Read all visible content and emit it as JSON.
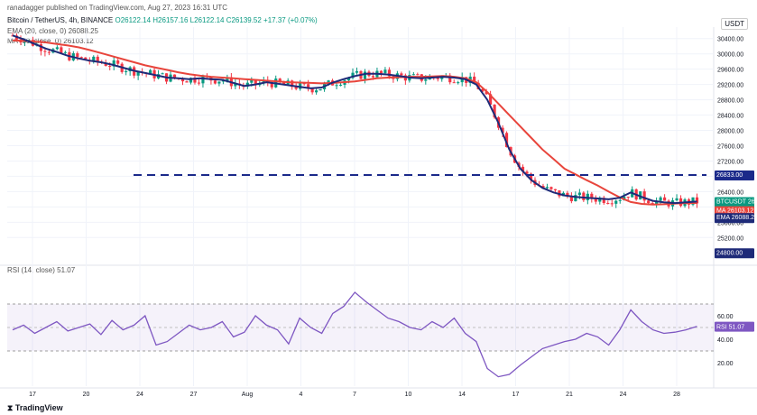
{
  "header": "ranadagger published on TradingView.com, Aug 27, 2023 16:31 UTC",
  "symbol_line": {
    "name": "Bitcoin / TetherUS, 4h, BINANCE",
    "ohlc": "O26122.14  H26157.16  L26122.14  C26139.52  +17.37 (+0.07%)"
  },
  "indicators": [
    {
      "label": "EMA (20, close, 0)",
      "value": "26088.25"
    },
    {
      "label": "MA (50, close, 0)",
      "value": "26103.12"
    }
  ],
  "rsi_label": "RSI (14, close)",
  "rsi_value": "51.07",
  "currency": "USDT",
  "footer": "TradingView",
  "tags": {
    "price": {
      "text": "BTCUSDT",
      "value": "26139.52",
      "delta": "-13.84%",
      "timer": "03:28:36"
    },
    "ma": {
      "text": "MA",
      "value": "26103.12"
    },
    "ema": {
      "text": "EMA",
      "value": "26088.25"
    },
    "level_high": "26833.00",
    "level_low": "24800.00",
    "rsi": {
      "text": "RSI",
      "value": "51.07"
    }
  },
  "colors": {
    "up": "#089981",
    "down": "#f23645",
    "ema": "#1e2a78",
    "ma": "#e8453c",
    "rsi": "#7e57c2",
    "level": "#1b2a8a",
    "grid": "#f0f3fa"
  },
  "chart_data": [
    {
      "type": "candlestick",
      "title": "Bitcoin / TetherUS, 4h, BINANCE",
      "ylabel": "USDT",
      "ylim": [
        24500,
        30700
      ],
      "x_ticks": [
        "17",
        "20",
        "24",
        "27",
        "Aug",
        "4",
        "7",
        "10",
        "14",
        "17",
        "21",
        "24",
        "28"
      ],
      "y_ticks": [
        30400,
        30000,
        29600,
        29200,
        28800,
        28400,
        28000,
        27600,
        27200,
        26800,
        26400,
        26000,
        25600,
        25200
      ],
      "levels": [
        26833,
        24800
      ],
      "series": [
        {
          "name": "EMA (20, close, 0)",
          "values": [
            30480,
            30380,
            30260,
            30140,
            30050,
            29950,
            29880,
            29820,
            29780,
            29720,
            29640,
            29560,
            29500,
            29440,
            29380,
            29360,
            29340,
            29360,
            29340,
            29320,
            29240,
            29160,
            29200,
            29260,
            29220,
            29180,
            29140,
            29100,
            29120,
            29250,
            29340,
            29420,
            29480,
            29480,
            29460,
            29420,
            29380,
            29360,
            29380,
            29400,
            29380,
            29340,
            29200,
            28800,
            28200,
            27500,
            27000,
            26700,
            26500,
            26380,
            26300,
            26260,
            26240,
            26220,
            26200,
            26240,
            26380,
            26260,
            26160,
            26120,
            26100,
            26120,
            26140
          ]
        },
        {
          "name": "MA (50, close, 0)",
          "values": [
            30350,
            30340,
            30320,
            30300,
            30260,
            30220,
            30170,
            30100,
            30020,
            29940,
            29860,
            29780,
            29700,
            29640,
            29580,
            29520,
            29470,
            29430,
            29400,
            29380,
            29360,
            29340,
            29320,
            29300,
            29280,
            29260,
            29250,
            29240,
            29230,
            29240,
            29260,
            29280,
            29320,
            29360,
            29380,
            29390,
            29400,
            29400,
            29410,
            29420,
            29400,
            29360,
            29260,
            29000,
            28700,
            28400,
            28100,
            27800,
            27500,
            27250,
            27000,
            26850,
            26700,
            26560,
            26400,
            26250,
            26130,
            26080,
            26060,
            26070,
            26090,
            26100,
            26103
          ]
        }
      ]
    },
    {
      "type": "line",
      "title": "RSI (14, close)",
      "ylim": [
        0,
        100
      ],
      "y_ticks": [
        60,
        40,
        20
      ],
      "band": [
        30,
        70
      ],
      "series": [
        {
          "name": "RSI",
          "values": [
            48,
            52,
            45,
            50,
            55,
            47,
            50,
            53,
            44,
            56,
            48,
            52,
            60,
            35,
            38,
            45,
            52,
            48,
            50,
            55,
            42,
            46,
            60,
            52,
            48,
            36,
            58,
            50,
            45,
            62,
            68,
            80,
            72,
            65,
            58,
            55,
            50,
            48,
            55,
            50,
            58,
            45,
            38,
            15,
            8,
            10,
            18,
            25,
            32,
            35,
            38,
            40,
            45,
            42,
            35,
            48,
            65,
            55,
            48,
            45,
            46,
            48,
            51
          ]
        }
      ]
    }
  ]
}
